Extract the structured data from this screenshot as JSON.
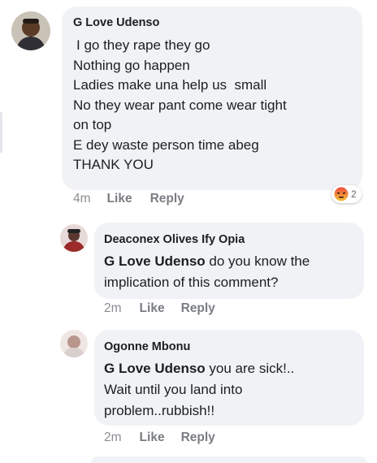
{
  "comment": {
    "author": "G Love Udenso",
    "lines": [
      "I go they rape they go",
      "Nothing go happen",
      "Ladies make una help us  small",
      "No they wear pant come wear tight",
      "on top",
      "E dey waste person time abeg",
      "THANK YOU"
    ],
    "time": "4m",
    "like_label": "Like",
    "reply_label": "Reply",
    "reaction": {
      "icon": "angry-reaction-icon",
      "count": "2"
    }
  },
  "replies": [
    {
      "author": "Deaconex Olives Ify Opia",
      "mention": "G Love Udenso",
      "text_first": " do you know the",
      "text_rest": "implication of this comment?",
      "time": "2m",
      "like_label": "Like",
      "reply_label": "Reply"
    },
    {
      "author": "Ogonne Mbonu",
      "mention": "G Love Udenso",
      "text_first": " you are sick!..",
      "lines_rest": [
        "Wait until you land into",
        "problem..rubbish!!"
      ],
      "time": "2m",
      "like_label": "Like",
      "reply_label": "Reply"
    }
  ],
  "colors": {
    "bubble": "#f0f2f5",
    "meta_text": "#7a7d82",
    "angry_top": "#f0493b",
    "angry_bottom": "#f5c33b"
  }
}
